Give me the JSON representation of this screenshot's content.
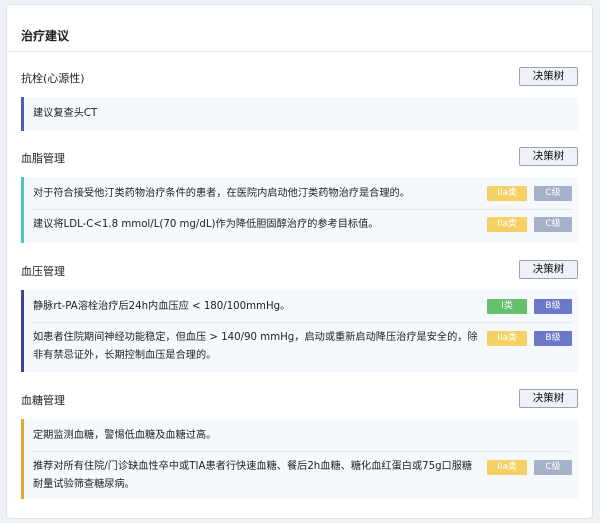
{
  "page_title": "治疗建议",
  "decision_label": "决策树",
  "colors": {
    "class_IIa": "#f5d165",
    "class_I": "#66bf6d",
    "level_C": "#a6b0c6",
    "level_B": "#6b78c9",
    "bar_blue": "#4a5dbe",
    "bar_teal": "#4fc5c0",
    "bar_purple": "#3e3f9c",
    "bar_orange": "#e3a63a"
  },
  "sections": [
    {
      "title": "抗栓(心源性)",
      "rows": [
        {
          "text": "建议复查头CT"
        }
      ]
    },
    {
      "title": "血脂管理",
      "rows": [
        {
          "text": "对于符合接受他汀类药物治疗条件的患者，在医院内启动他汀类药物治疗是合理的。",
          "class": "IIa类",
          "level": "C级"
        },
        {
          "text": "建议将LDL-C<1.8 mmol/L(70 mg/dL)作为降低胆固醇治疗的参考目标值。",
          "class": "IIa类",
          "level": "C级"
        }
      ]
    },
    {
      "title": "血压管理",
      "rows": [
        {
          "text": "静脉rt-PA溶栓治疗后24h内血压应 < 180/100mmHg。",
          "class": "I类",
          "level": "B级"
        },
        {
          "text_line1": "如患者住院期间神经功能稳定，但血压 > 140/90 mmHg，启动或重新启动降压治疗是安全的，除",
          "text_line2": "非有禁忌证外，长期控制血压是合理的。",
          "class": "IIa类",
          "level": "B级"
        }
      ]
    },
    {
      "title": "血糖管理",
      "rows": [
        {
          "text": "定期监测血糖，警惕低血糖及血糖过高。"
        },
        {
          "text_line1": "推荐对所有住院/门诊缺血性卒中或TIA患者行快速血糖、餐后2h血糖、糖化血红蛋白或75g口服糖",
          "text_line2": "耐量试验筛查糖尿病。",
          "class": "IIa类",
          "level": "C级"
        }
      ]
    }
  ]
}
